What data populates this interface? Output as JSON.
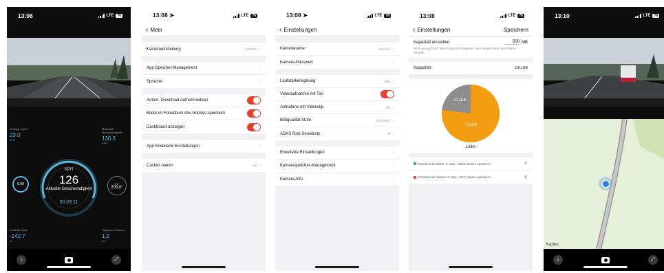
{
  "colors": {
    "accent_red": "#e8402f",
    "accent_blue": "#5ab8e0",
    "pie_orange": "#f39c12",
    "pie_gray": "#8e8e8e"
  },
  "screen1": {
    "time": "13:06",
    "network": "LTE",
    "battery": "76",
    "stats": {
      "avg_label": "Average speed",
      "avg_value": "23.0",
      "avg_unit": "KPH",
      "max_label": "Maximale Geschwindigkeit",
      "max_value": "130.5",
      "max_unit": "KPH",
      "alt_label": "Vertikale Höhe",
      "alt_value": "-142.7",
      "alt_unit": "m",
      "dist_label": "Gefahrene Strecke",
      "dist_value": "1.2",
      "dist_unit": "km"
    },
    "gauge": {
      "unit": "KPH",
      "speed": "126",
      "label": "Aktuelle Geschwindigkeit",
      "elapsed": "00:03:11",
      "heading": "205.0°",
      "heading_dir": "SW",
      "gforce": "0.90"
    }
  },
  "screen2": {
    "time": "13:08",
    "back_label": "Mein",
    "rows": [
      {
        "label": "Kameraeinstellung",
        "value": "Hatchfire"
      },
      {
        "label": "App-Speicher-Management"
      },
      {
        "label": "Sprache"
      },
      {
        "label": "Autom. Download Aufnahmedatei",
        "toggle": true
      },
      {
        "label": "Bilder im Fotoalbum des Handys speichern",
        "toggle": true
      },
      {
        "label": "Dashboard anzeigen",
        "toggle": true
      },
      {
        "label": "App Erweiterte Einstellungen"
      },
      {
        "label": "Caches leeren",
        "value": "2M"
      }
    ]
  },
  "screen3": {
    "time": "13:08",
    "back_label": "Einstellungen",
    "rows": [
      {
        "label": "Kameraname",
        "value": "Hatchfire"
      },
      {
        "label": "Kamera-Passwort"
      },
      {
        "label": "Lautstärkeregelung",
        "value": "Stille"
      },
      {
        "label": "Videoaufnahme mit Ton",
        "toggle": true
      },
      {
        "label": "Aufnahme mit Videoclip",
        "value": "15s"
      },
      {
        "label": "Bildqualität Stufe",
        "value": "4K(2160P)"
      },
      {
        "label": "ADAS Risk Sensitivity",
        "value": "off"
      },
      {
        "label": "Erweiterte Einstellungen"
      },
      {
        "label": "Kameraspeicher-Management"
      },
      {
        "label": "Kamera-Info."
      }
    ]
  },
  "screen4": {
    "time": "13:08",
    "back_label": "Einstellungen",
    "save_label": "Speichern",
    "capacity_label": "Kapazität einstellen",
    "capacity_value": "500",
    "capacity_unit": "MB",
    "hint": "Nicht genug Platz. Mehr Kapazität freigeben oder einige Fotos oder Videos löschen",
    "total_label": "Kapazität:",
    "total_value": "118.1GB",
    "pie_small_label": "21.1GB",
    "pie_large_label": "71.1GB",
    "pie_small_fraction": 0.23,
    "pie_caption": "Links",
    "legend1": "Existierende Bilder: 6, Max. 21918 weitere speichern",
    "legend2": "Existierende Videos: 9, Max. 4467 weitere speichern"
  },
  "screen5": {
    "time": "13:10",
    "network": "LTE",
    "battery": "76",
    "map_label": "Karten"
  }
}
